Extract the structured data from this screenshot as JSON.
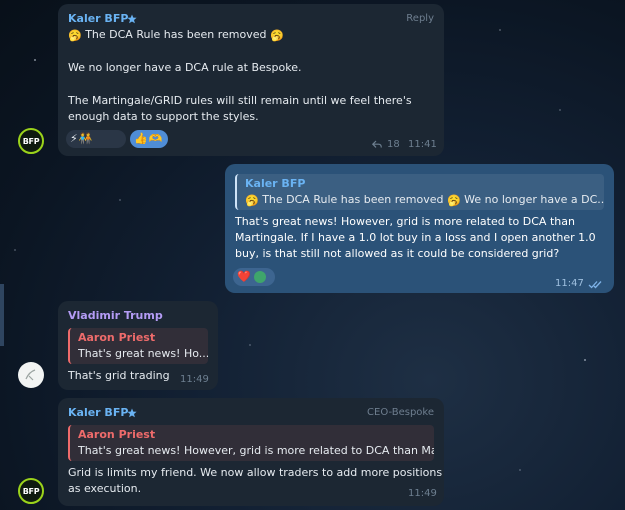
{
  "messages": [
    {
      "sender": "Kaler BFP",
      "corner": "Reply",
      "line1_text": "The DCA Rule has been removed",
      "line2": "We no longer have a DCA rule at Bespoke.",
      "line3": "The Martingale/GRID rules will still remain until we feel there's",
      "line4": "enough data to support the styles.",
      "emoji_face": "🥱",
      "reactions": [
        "⚡",
        "🧑‍🤝‍🧑",
        "👍",
        "🫶"
      ],
      "reply_count": "18",
      "time": "11:41",
      "avatar_text": "BFP"
    },
    {
      "reply_name": "Kaler BFP",
      "reply_text": "The DCA Rule has been removed",
      "reply_text_tail": "We no longer have a DC...",
      "emoji_face": "🥱",
      "lines": [
        "That's great news! However, grid is more related to DCA than",
        "Martingale. If I have a 1.0 lot buy in a loss and I open another 1.0",
        "buy, is that still not allowed as it could be considered grid?"
      ],
      "reactions": [
        "❤️",
        "👤"
      ],
      "time": "11:47",
      "status": "✓✓"
    },
    {
      "sender": "Vladimir Trump",
      "reply_name": "Aaron Priest",
      "reply_text": "That's great news! Ho...",
      "text": "That's grid trading",
      "time": "11:49"
    },
    {
      "sender": "Kaler BFP",
      "corner": "CEO-Bespoke",
      "reply_name": "Aaron Priest",
      "reply_text": "That's great news! However, grid is more related to DCA than Ma...",
      "lines": [
        "Grid is limits my friend. We now allow traders to add more positions",
        "as execution."
      ],
      "time": "11:49",
      "avatar_text": "BFP"
    }
  ],
  "colors": {
    "incoming_bubble": "#1c2733",
    "outgoing_bubble": "#2b5278",
    "name_blue": "#6ab3f3",
    "name_purple": "#b49cf5",
    "name_red": "#ee6b6b",
    "avatar_ring": "#9bd31b"
  },
  "icons": [
    "star-icon",
    "reply-arrow-icon",
    "double-check-icon"
  ]
}
